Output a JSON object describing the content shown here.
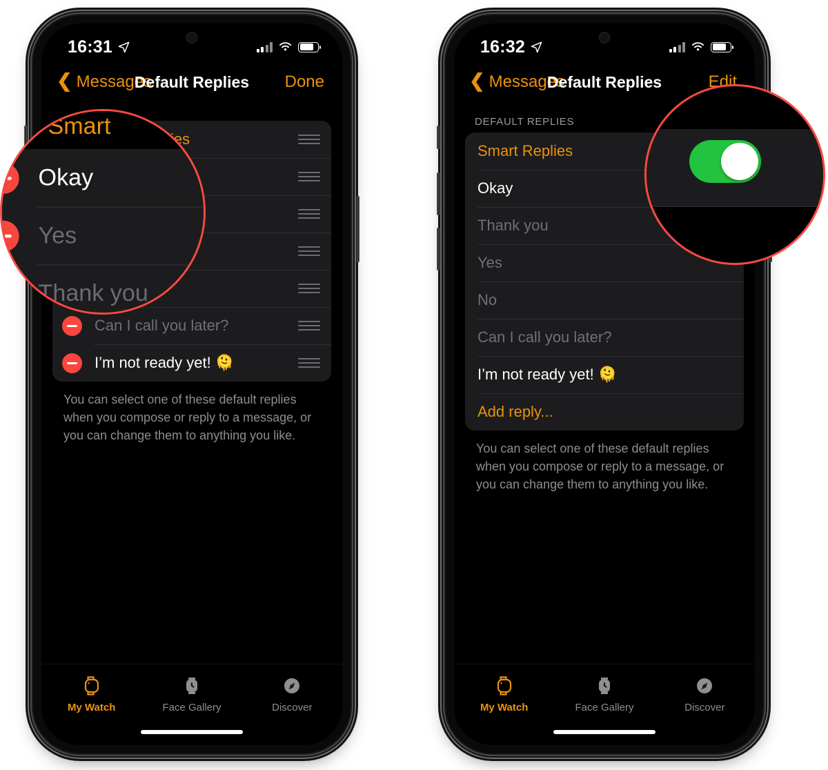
{
  "accent_color": "#e9920e",
  "toggle_on_color": "#22c33e",
  "delete_button_color": "#f9463e",
  "callout_color": "#fc4a42",
  "phones": [
    {
      "id": "left",
      "status": {
        "time": "16:31",
        "location_icon": "location-arrow-icon",
        "cellular_icon": "cellular-bars-icon",
        "wifi_icon": "wifi-icon",
        "battery_icon": "battery-icon"
      },
      "nav": {
        "back_label": "Messages",
        "title": "Default Replies",
        "action_label": "Done"
      },
      "section_header": "",
      "mode": "editing",
      "rows": [
        {
          "label": "Smart Replies",
          "style": "accent",
          "deletable": true,
          "draggable": true
        },
        {
          "label": "Okay",
          "style": "normal",
          "deletable": true,
          "draggable": true
        },
        {
          "label": "Thank you",
          "style": "dim",
          "deletable": true,
          "draggable": true
        },
        {
          "label": "Yes",
          "style": "dim",
          "deletable": true,
          "draggable": true
        },
        {
          "label": "No",
          "style": "dim",
          "deletable": true,
          "draggable": true
        },
        {
          "label": "Can I call you later?",
          "style": "dim",
          "deletable": true,
          "draggable": true
        },
        {
          "label": "I’m not ready yet! 🫠",
          "style": "normal",
          "deletable": true,
          "draggable": true
        }
      ],
      "footnote": "You can select one of these default replies when you compose or reply to a message, or you can change them to anything you like.",
      "loupe": {
        "title": "Smart",
        "rows": [
          {
            "label": "Okay",
            "style": "normal"
          },
          {
            "label": "Yes",
            "style": "dim"
          },
          {
            "label": "Thank you",
            "style": "dim"
          }
        ]
      }
    },
    {
      "id": "right",
      "status": {
        "time": "16:32",
        "location_icon": "location-arrow-icon",
        "cellular_icon": "cellular-bars-icon",
        "wifi_icon": "wifi-icon",
        "battery_icon": "battery-icon"
      },
      "nav": {
        "back_label": "Messages",
        "title": "Default Replies",
        "action_label": "Edit"
      },
      "section_header": "Default Replies",
      "mode": "viewing",
      "rows": [
        {
          "label": "Smart Replies",
          "style": "accent",
          "toggle": true,
          "toggle_on": true
        },
        {
          "label": "Okay",
          "style": "normal"
        },
        {
          "label": "Thank you",
          "style": "dim"
        },
        {
          "label": "Yes",
          "style": "dim"
        },
        {
          "label": "No",
          "style": "dim"
        },
        {
          "label": "Can I call you later?",
          "style": "dim"
        },
        {
          "label": "I’m not ready yet! 🫠",
          "style": "normal"
        },
        {
          "label": "Add reply...",
          "style": "accent"
        }
      ],
      "footnote": "You can select one of these default replies when you compose or reply to a message, or you can change them to anything you like."
    }
  ],
  "tabbar": {
    "items": [
      {
        "label": "My Watch",
        "icon": "watch-icon",
        "active": true
      },
      {
        "label": "Face Gallery",
        "icon": "watch-face-icon",
        "active": false
      },
      {
        "label": "Discover",
        "icon": "compass-icon",
        "active": false
      }
    ]
  }
}
